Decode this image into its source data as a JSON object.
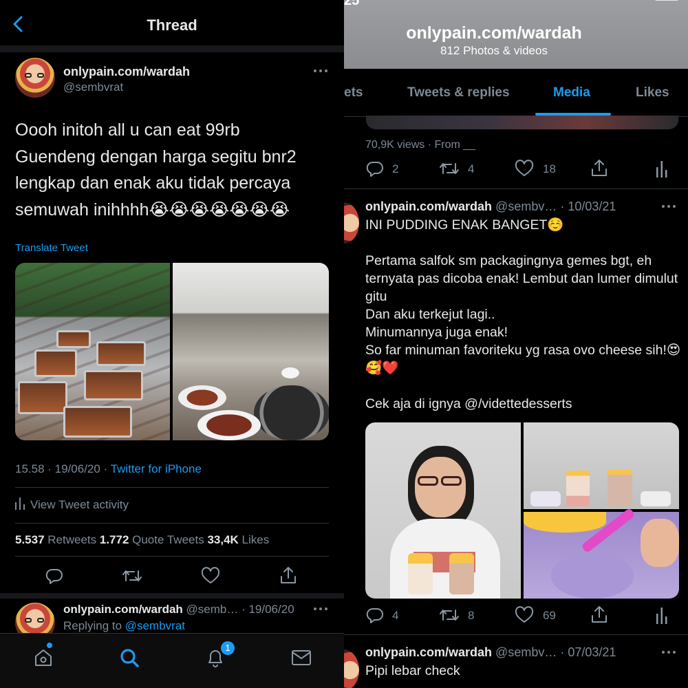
{
  "left": {
    "header": {
      "title": "Thread"
    },
    "tweet": {
      "name": "onlypain.com/wardah",
      "handle": "@sembvrat",
      "text": "Oooh initoh all u can eat 99rb\nGuendeng dengan harga segitu bnr2\nlengkap dan enak aku tidak percaya\nsemuwah inihhhh😭😭😭😭😭😭😭",
      "translate": "Translate Tweet",
      "time": "15.58 · 19/06/20 · ",
      "client": "Twitter for iPhone",
      "activity": "View Tweet activity",
      "stats": {
        "retweets_count": "5.537",
        "retweets_label": " Retweets  ",
        "quotes_count": "1.772",
        "quotes_label": " Quote Tweets  ",
        "likes_count": "33,4K",
        "likes_label": " Likes"
      }
    },
    "reply": {
      "name": "onlypain.com/wardah",
      "meta": " @semb… · 19/06/20",
      "replying_prefix": "Replying to ",
      "replying_handle": "@sembvrat"
    },
    "tabbar": {
      "notifications_badge": "1"
    }
  },
  "right": {
    "status": {
      "time": "25"
    },
    "header": {
      "title": "onlypain.com/wardah",
      "subtitle": "812 Photos & videos"
    },
    "tabs": [
      "ets",
      "Tweets & replies",
      "Media",
      "Likes"
    ],
    "active_tab": "Media",
    "prev_tweet": {
      "views": "70,9K views · From __",
      "replies": "2",
      "retweets": "4",
      "likes": "18"
    },
    "tweet": {
      "name": "onlypain.com/wardah",
      "meta": " @sembv… · 10/03/21",
      "text": "INI PUDDING ENAK BANGET☺️\n\nPertama salfok sm packagingnya gemes bgt, eh ternyata pas dicoba enak! Lembut dan lumer dimulut gitu\nDan aku terkejut lagi..\nMinumannya juga enak!\nSo far minuman favoriteku yg rasa ovo cheese sih!😍🥰❤️\n\nCek aja di ignya @/videttedesserts",
      "replies": "4",
      "retweets": "8",
      "likes": "69"
    },
    "next_tweet": {
      "name": "onlypain.com/wardah",
      "meta": " @sembv… · 07/03/21",
      "text": "Pipi lebar check"
    }
  },
  "icons": [
    "back-chevron-icon",
    "more-icon",
    "reply-icon",
    "retweet-icon",
    "like-icon",
    "share-icon",
    "analytics-icon",
    "home-icon",
    "search-icon",
    "notifications-icon",
    "messages-icon"
  ]
}
